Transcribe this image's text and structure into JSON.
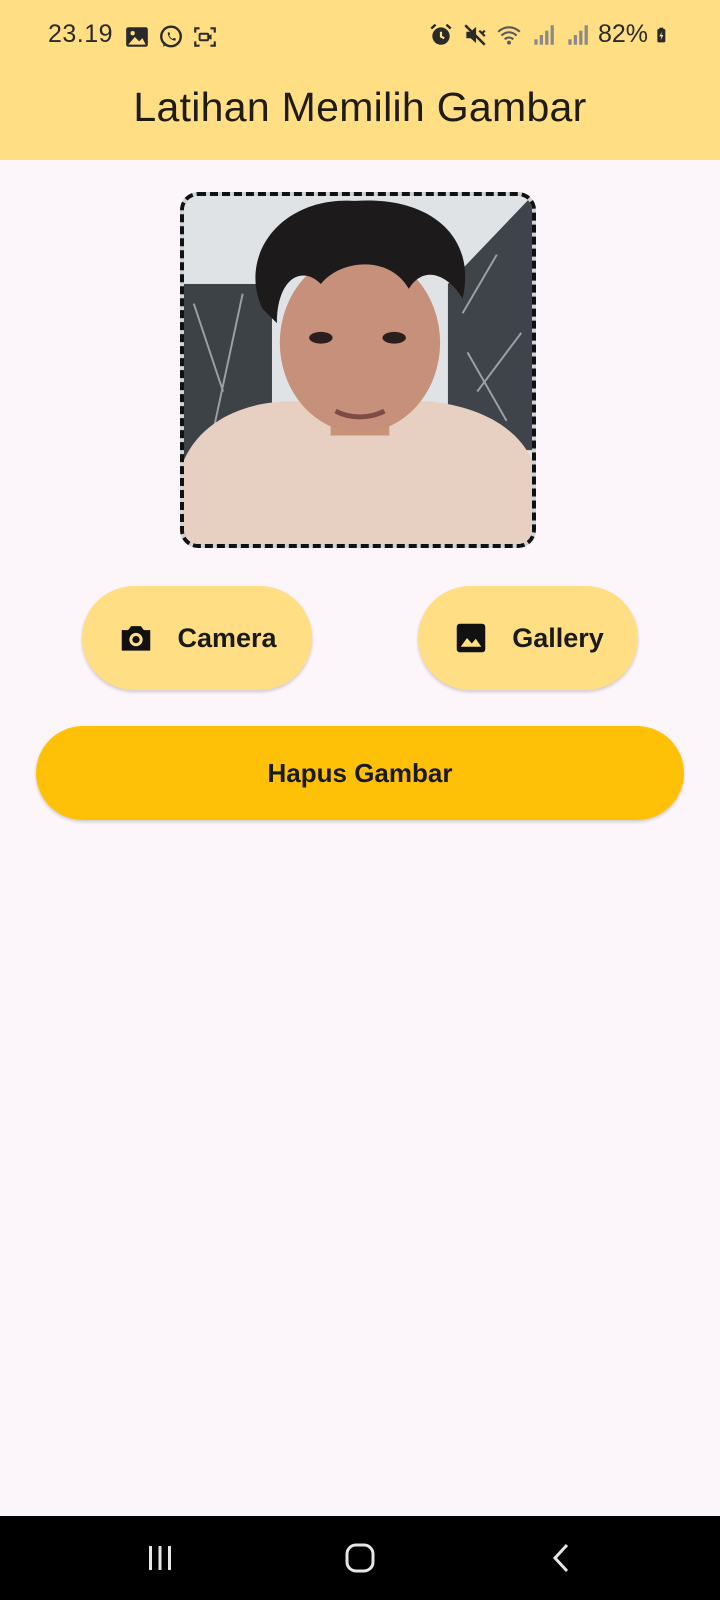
{
  "status_bar": {
    "time": "23.19",
    "battery": "82%",
    "left_icons": [
      "image-icon",
      "whatsapp-icon",
      "screen-record-icon"
    ],
    "right_icons": [
      "alarm-icon",
      "mute-icon",
      "wifi-icon",
      "signal-icon",
      "signal-icon",
      "battery-charging-icon"
    ]
  },
  "app_bar": {
    "title": "Latihan Memilih Gambar"
  },
  "preview": {
    "content": "selected-photo"
  },
  "buttons": {
    "camera_label": "Camera",
    "camera_icon": "camera-icon",
    "gallery_label": "Gallery",
    "gallery_icon": "image-icon",
    "delete_label": "Hapus Gambar"
  },
  "nav_bar": {
    "items": [
      "recents-icon",
      "home-icon",
      "back-icon"
    ]
  },
  "colors": {
    "header": "#ffde84",
    "background": "#fcf6fb",
    "pill_button": "#ffde84",
    "delete_button": "#ffc107",
    "nav_bar": "#000000"
  }
}
